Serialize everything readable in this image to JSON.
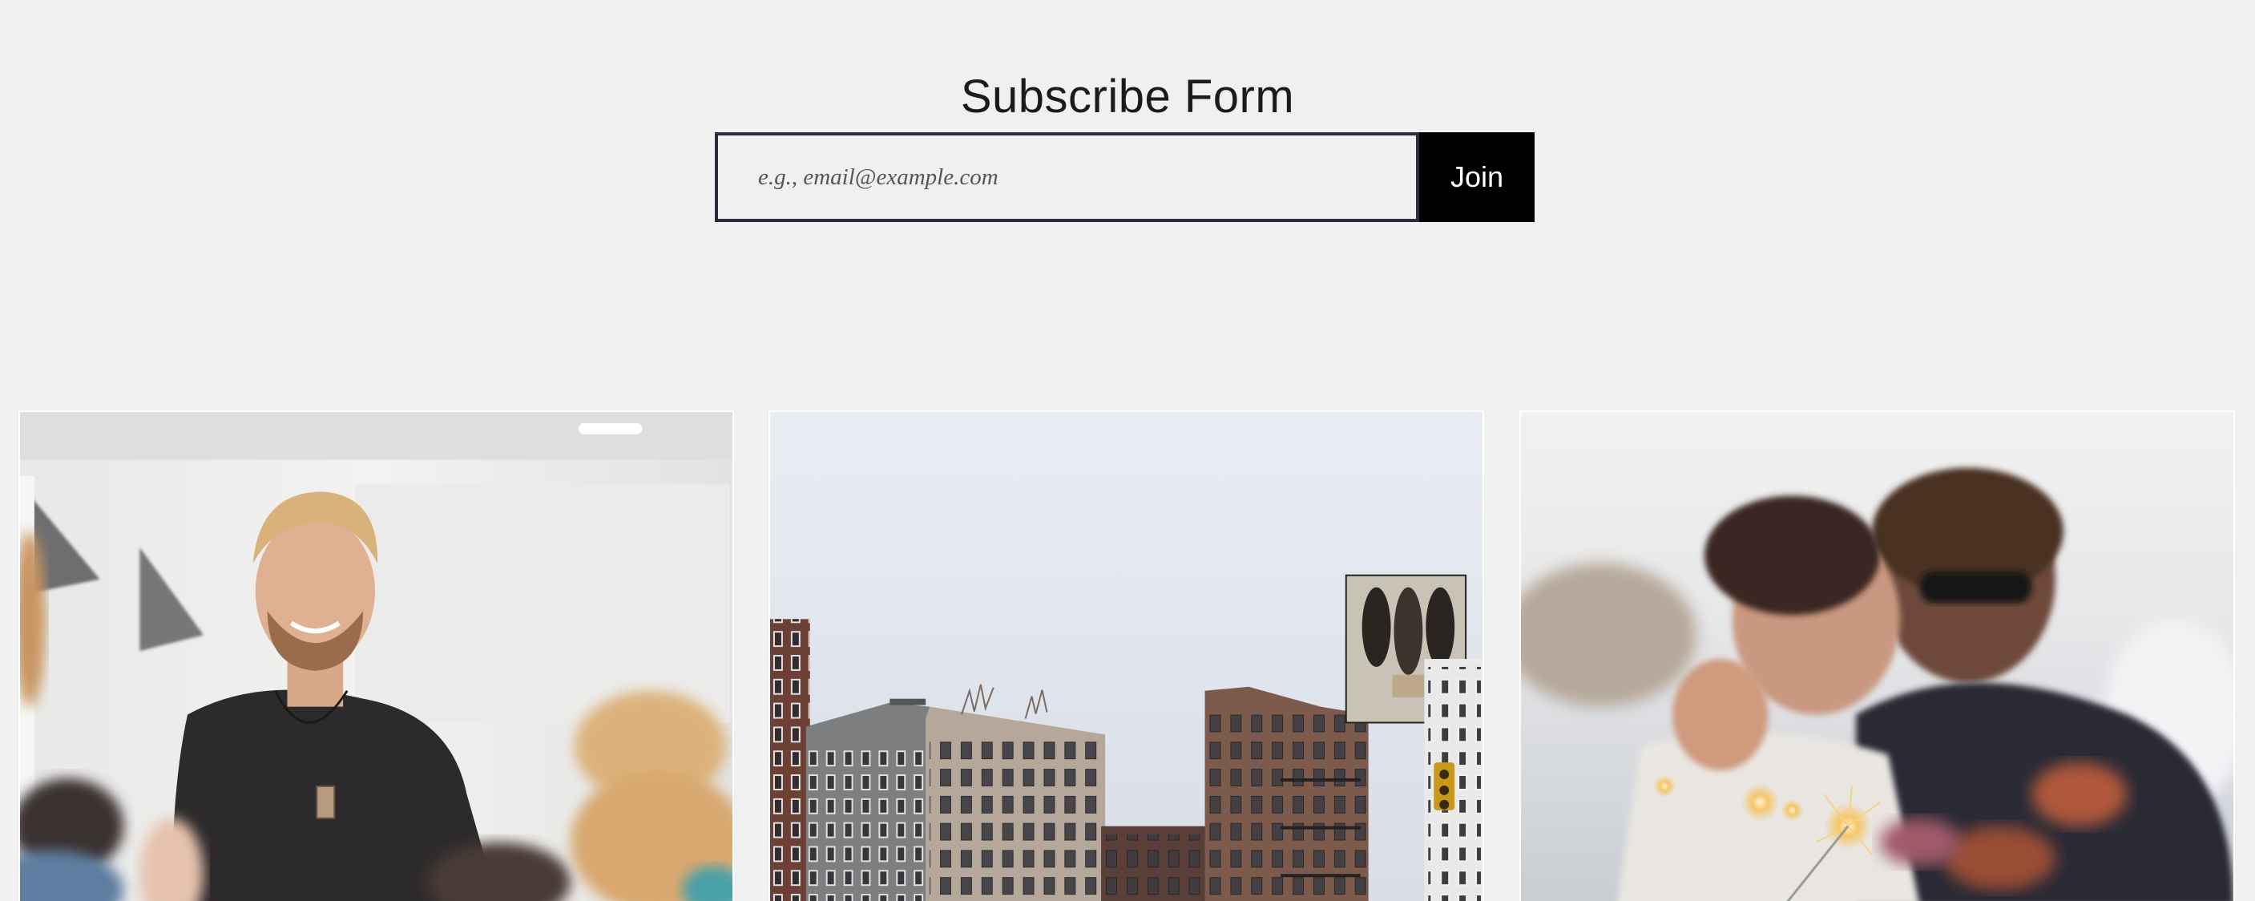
{
  "subscribe": {
    "title": "Subscribe Form",
    "email_placeholder": "e.g., email@example.com",
    "email_value": "",
    "join_label": "Join"
  },
  "colors": {
    "background": "#f0f0f0",
    "button": "#000000",
    "input_border": "#2b2b3a"
  },
  "gallery": {
    "items": [
      {
        "icon": "presenter-photo"
      },
      {
        "icon": "city-buildings-photo"
      },
      {
        "icon": "couple-sparklers-photo"
      }
    ]
  }
}
